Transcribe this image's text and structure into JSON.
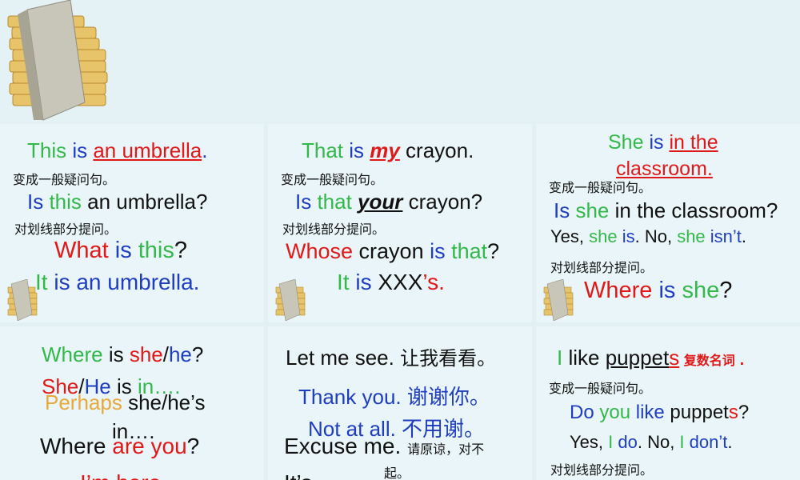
{
  "p1": {
    "l1": [
      "This ",
      "is ",
      "an umbrella",
      "."
    ],
    "cn1": "变成一般疑问句。",
    "l2": [
      "Is ",
      "this ",
      "an umbrella?"
    ],
    "cn2": "对划线部分提问。",
    "l3": [
      "What ",
      "is ",
      "this",
      "?"
    ],
    "l4": [
      "It ",
      "is ",
      "an umbrella."
    ]
  },
  "p2": {
    "l1": [
      "That ",
      "is ",
      "my",
      " crayon."
    ],
    "cn1": "变成一般疑问句。",
    "l2": [
      "Is ",
      "that ",
      "your",
      " crayon?"
    ],
    "cn2": "对划线部分提问。",
    "l3": [
      "Whose ",
      "crayon ",
      "is ",
      "that",
      "?"
    ],
    "l4": [
      "It ",
      "is ",
      "XXX",
      "’s."
    ]
  },
  "p3": {
    "l1": [
      "She ",
      "is ",
      "in the"
    ],
    "l1b": "classroom.",
    "cn1": "变成一般疑问句。",
    "l2": [
      "Is ",
      "she ",
      "in the classroom?"
    ],
    "l3": [
      "Yes, ",
      "she ",
      "is",
      ". No, ",
      "she ",
      "isn’t",
      "."
    ],
    "cn2": "对划线部分提问。",
    "l4": [
      "Where ",
      "is ",
      "she",
      "?"
    ]
  },
  "p4": {
    "l1": [
      "Where ",
      "is ",
      "she",
      "/",
      "he",
      "?"
    ],
    "l2": [
      "She",
      "/",
      "He ",
      "is ",
      "in…."
    ],
    "l3": [
      "Perhaps ",
      "she/he’s"
    ],
    "l3b": "in….",
    "l4": [
      "Where ",
      "are ",
      "you",
      "?"
    ],
    "l5": "I’m here."
  },
  "p5": {
    "l1": [
      "Let me see. ",
      "让我看看。"
    ],
    "l2": "Thank you. 谢谢你。",
    "l3": "Not at all. 不用谢。",
    "l4": [
      "Excuse me. ",
      "请原谅，对不"
    ],
    "l4b": "起。",
    "l5": "It’s"
  },
  "p6": {
    "l1": [
      "I ",
      "like ",
      "puppet",
      "s",
      " 复数名词 ."
    ],
    "cn1": "变成一般疑问句。",
    "l2": [
      "Do ",
      "you ",
      "like ",
      "puppet",
      "s",
      "?"
    ],
    "l3": [
      "Yes, ",
      "I ",
      "do",
      ". No, ",
      "I ",
      "don’t",
      "."
    ],
    "cn2": "对划线部分提问。"
  }
}
